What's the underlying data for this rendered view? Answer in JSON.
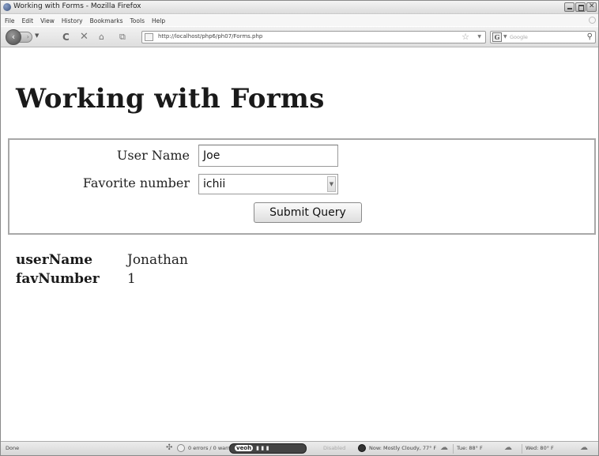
{
  "window": {
    "title": "Working with Forms - Mozilla Firefox"
  },
  "menu": [
    "File",
    "Edit",
    "View",
    "History",
    "Bookmarks",
    "Tools",
    "Help"
  ],
  "address_bar": {
    "url": "http://localhost/php6/ph07/Forms.php"
  },
  "search_bar": {
    "placeholder": "Google"
  },
  "page": {
    "title": "Working with Forms",
    "form": {
      "user_name_label": "User Name",
      "user_name_value": "Joe",
      "favorite_number_label": "Favorite number",
      "favorite_number_value": "ichii",
      "submit_label": "Submit Query"
    },
    "results": [
      {
        "key": "userName",
        "value": "Jonathan"
      },
      {
        "key": "favNumber",
        "value": "1"
      }
    ]
  },
  "status_bar": {
    "status": "Done",
    "validator": "0 errors / 0 warnings",
    "veoh": "veoh",
    "disabled": "Disabled",
    "weather_now": "Now: Mostly Cloudy, 77° F",
    "forecast_tue": "Tue: 88° F",
    "forecast_wed": "Wed: 80° F"
  }
}
